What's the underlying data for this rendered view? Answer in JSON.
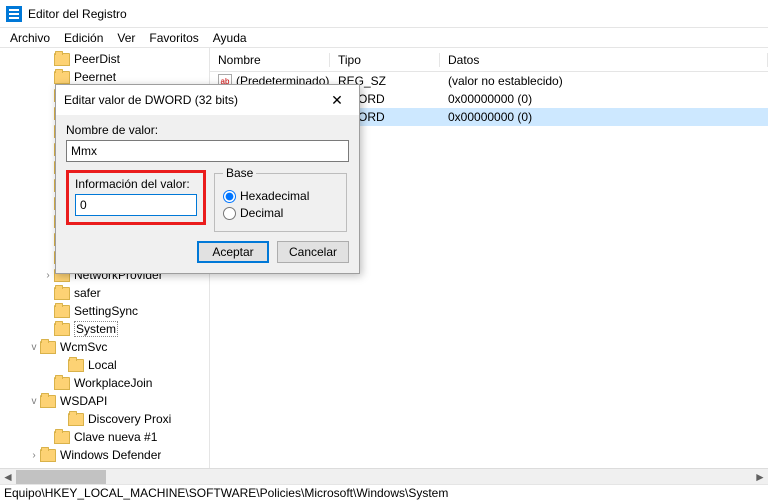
{
  "titlebar": {
    "title": "Editor del Registro"
  },
  "menubar": {
    "items": [
      "Archivo",
      "Edición",
      "Ver",
      "Favoritos",
      "Ayuda"
    ]
  },
  "tree": {
    "items": [
      {
        "indent": 3,
        "expander": "",
        "label": "PeerDist"
      },
      {
        "indent": 3,
        "expander": "",
        "label": "Peernet"
      },
      {
        "indent": 3,
        "expander": "",
        "label": ""
      },
      {
        "indent": 3,
        "expander": "",
        "label": ""
      },
      {
        "indent": 3,
        "expander": "",
        "label": ""
      },
      {
        "indent": 3,
        "expander": "",
        "label": ""
      },
      {
        "indent": 3,
        "expander": "",
        "label": ""
      },
      {
        "indent": 3,
        "expander": "",
        "label": ""
      },
      {
        "indent": 3,
        "expander": "",
        "label": ""
      },
      {
        "indent": 3,
        "expander": "",
        "label": ""
      },
      {
        "indent": 3,
        "expander": "",
        "label": ""
      },
      {
        "indent": 3,
        "expander": "",
        "label": ""
      },
      {
        "indent": 3,
        "expander": "›",
        "label": "NetworkProvider"
      },
      {
        "indent": 3,
        "expander": "",
        "label": "safer"
      },
      {
        "indent": 3,
        "expander": "",
        "label": "SettingSync"
      },
      {
        "indent": 3,
        "expander": "",
        "label": "System",
        "selected": true
      },
      {
        "indent": 2,
        "expander": "v",
        "label": "WcmSvc"
      },
      {
        "indent": 4,
        "expander": "",
        "label": "Local"
      },
      {
        "indent": 3,
        "expander": "",
        "label": "WorkplaceJoin"
      },
      {
        "indent": 2,
        "expander": "v",
        "label": "WSDAPI"
      },
      {
        "indent": 4,
        "expander": "",
        "label": "Discovery Proxi"
      },
      {
        "indent": 3,
        "expander": "",
        "label": "Clave nueva #1"
      },
      {
        "indent": 2,
        "expander": "›",
        "label": "Windows Defender"
      }
    ]
  },
  "list": {
    "headers": {
      "name": "Nombre",
      "type": "Tipo",
      "data": "Datos"
    },
    "rows": [
      {
        "icon": "str",
        "name": "(Predeterminado)",
        "type": "REG_SZ",
        "data": "(valor no establecido)"
      },
      {
        "icon": "num",
        "name": "",
        "type": "DWORD",
        "data": "0x00000000 (0)"
      },
      {
        "icon": "num",
        "name": "",
        "type": "DWORD",
        "data": "0x00000000 (0)",
        "selected": true
      }
    ]
  },
  "statusbar": {
    "path": "Equipo\\HKEY_LOCAL_MACHINE\\SOFTWARE\\Policies\\Microsoft\\Windows\\System"
  },
  "dialog": {
    "title": "Editar valor de DWORD (32 bits)",
    "name_label": "Nombre de valor:",
    "name_value": "Mmx",
    "data_label": "Información del valor:",
    "data_value": "0",
    "base_legend": "Base",
    "radio_hex": "Hexadecimal",
    "radio_dec": "Decimal",
    "ok": "Aceptar",
    "cancel": "Cancelar"
  }
}
